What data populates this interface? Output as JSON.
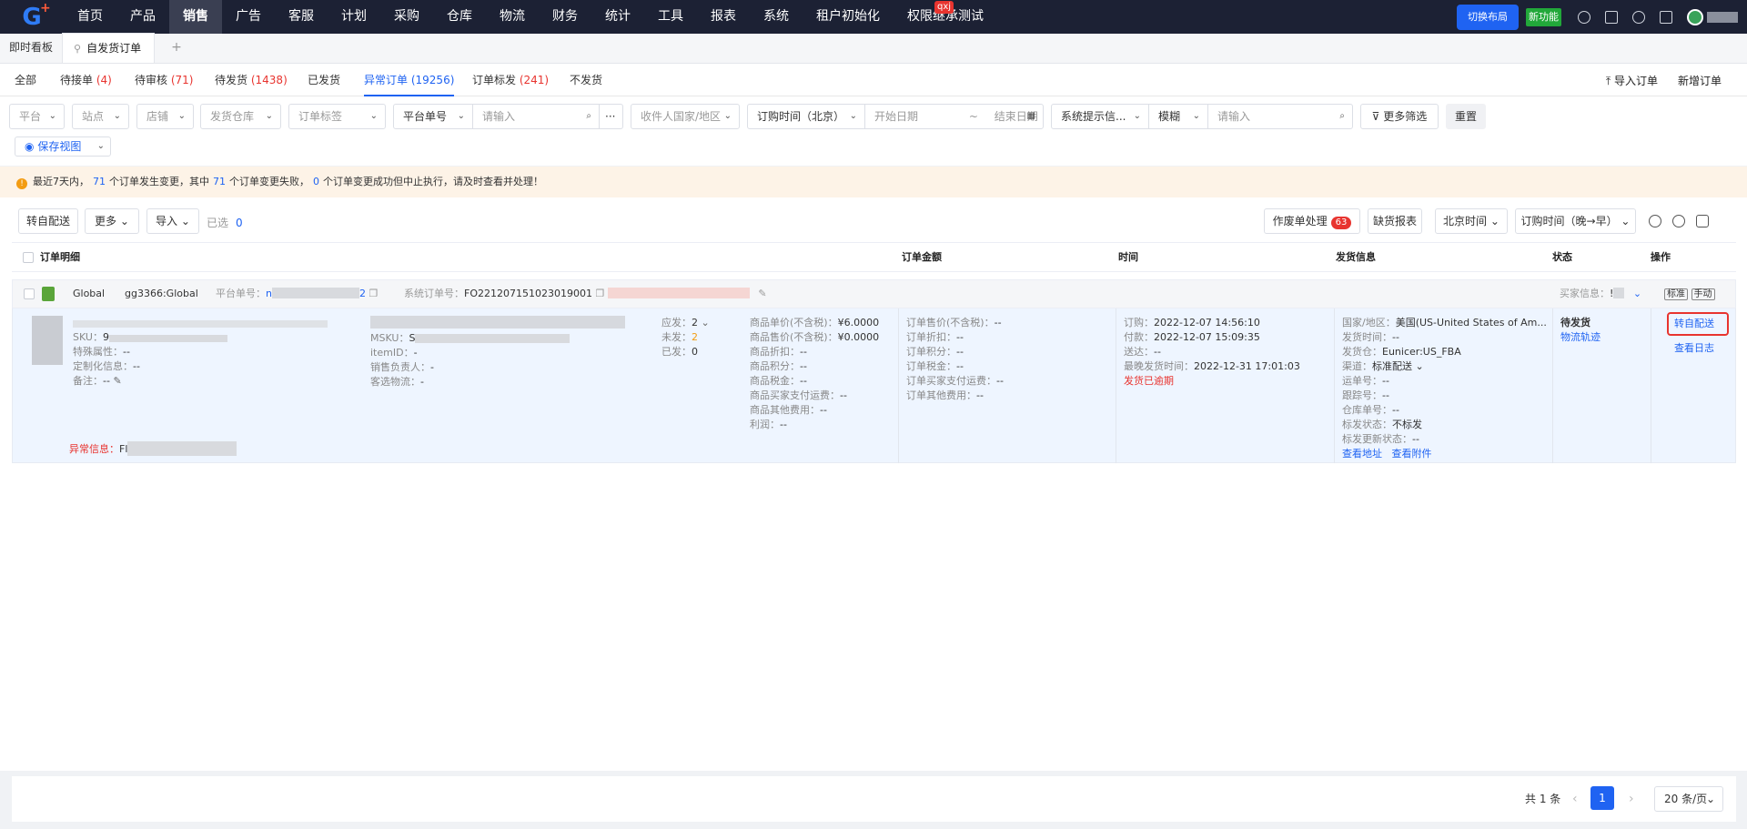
{
  "nav": {
    "logo": "G",
    "items": [
      "首页",
      "产品",
      "销售",
      "广告",
      "客服",
      "计划",
      "采购",
      "仓库",
      "物流",
      "财务",
      "统计",
      "工具",
      "报表",
      "系统",
      "租户初始化",
      "权限继承测试"
    ],
    "active_index": 2,
    "badge": "qxj",
    "switch_layout": "切换布局",
    "new_feature": "新功能"
  },
  "pagetabs": {
    "dashboard": "即时看板",
    "current": "自发货订单",
    "add": "+"
  },
  "status_tabs": [
    {
      "label": "全部",
      "count": ""
    },
    {
      "label": "待接单",
      "count": "(4)"
    },
    {
      "label": "待审核",
      "count": "(71)"
    },
    {
      "label": "待发货",
      "count": "(1438)"
    },
    {
      "label": "已发货",
      "count": ""
    },
    {
      "label": "异常订单",
      "count": "(19256)"
    },
    {
      "label": "订单标发",
      "count": "(241)"
    },
    {
      "label": "不发货",
      "count": ""
    }
  ],
  "top_actions": {
    "import": "导入订单",
    "create": "新增订单"
  },
  "filters": {
    "platform": "平台",
    "site": "站点",
    "store": "店铺",
    "warehouse": "发货仓库",
    "tag": "订单标签",
    "order_no_type": "平台单号",
    "search_placeholder": "请输入",
    "more_dots": "···",
    "country": "收件人国家/地区",
    "time_type": "订购时间（北京）",
    "start_date": "开始日期",
    "date_sep": "~",
    "end_date": "结束日期",
    "sys_hint": "系统提示信...",
    "match": "模糊",
    "search2_placeholder": "请输入",
    "more_filters": "更多筛选",
    "reset": "重置",
    "save_view": "保存视图"
  },
  "alert": {
    "prefix": "最近7天内，",
    "n1": "71",
    "t1": "个订单发生变更，其中",
    "n2": "71",
    "t2": "个订单变更失败，",
    "n3": "0",
    "t3": "个订单变更成功但中止执行，请及时查看并处理！"
  },
  "toolbar": {
    "to_self": "转自配送",
    "more": "更多",
    "import": "导入",
    "selected_label": "已选",
    "selected_count": "0",
    "void_process": "作废单处理",
    "void_count": "63",
    "shortage_report": "缺货报表",
    "beijing_time": "北京时间",
    "sort": "订购时间（晚→早）"
  },
  "table_headers": {
    "detail": "订单明细",
    "amount": "订单金额",
    "time": "时间",
    "shipping": "发货信息",
    "status": "状态",
    "ops": "操作"
  },
  "order": {
    "store_region": "Global",
    "store_name": "gg3366:Global",
    "platform_no_label": "平台单号：",
    "platform_no_start": "n",
    "platform_no_end": "2",
    "sys_no_label": "系统订单号：",
    "sys_no": "FO221207151023019001",
    "buyer_label": "买家信息：",
    "buyer_start": "!",
    "tag_std": "标准",
    "tag_manual": "手动",
    "sku_label": "SKU：",
    "sku_start": "9",
    "special_label": "特殊属性：",
    "special": "--",
    "custom_label": "定制化信息：",
    "custom": "--",
    "note_label": "备注：",
    "note": "--",
    "msku_label": "MSKU：",
    "msku_start": "S",
    "itemid_label": "itemID：",
    "itemid": "-",
    "sales_label": "销售负责人：",
    "sales": "-",
    "cust_logistics_label": "客选物流：",
    "cust_logistics": "-",
    "qty_should_label": "应发：",
    "qty_should": "2",
    "qty_unsent_label": "未发：",
    "qty_unsent": "2",
    "qty_sent_label": "已发：",
    "qty_sent": "0",
    "price_rows": [
      {
        "label": "商品单价(不含税)：",
        "value": "¥6.0000"
      },
      {
        "label": "商品售价(不含税)：",
        "value": "¥0.0000"
      },
      {
        "label": "商品折扣：",
        "value": "--"
      },
      {
        "label": "商品积分：",
        "value": "--"
      },
      {
        "label": "商品税金：",
        "value": "--"
      },
      {
        "label": "商品买家支付运费：",
        "value": "--"
      },
      {
        "label": "商品其他费用：",
        "value": "--"
      },
      {
        "label": "利润：",
        "value": "--"
      }
    ],
    "amount_rows": [
      {
        "label": "订单售价(不含税)：",
        "value": "--"
      },
      {
        "label": "订单折扣：",
        "value": "--"
      },
      {
        "label": "订单积分：",
        "value": "--"
      },
      {
        "label": "订单税金：",
        "value": "--"
      },
      {
        "label": "订单买家支付运费：",
        "value": "--"
      },
      {
        "label": "订单其他费用：",
        "value": "--"
      }
    ],
    "time_rows": [
      {
        "label": "订购：",
        "value": "2022-12-07 14:56:10"
      },
      {
        "label": "付款：",
        "value": "2022-12-07 15:09:35"
      },
      {
        "label": "送达：",
        "value": "--"
      },
      {
        "label": "最晚发货时间：",
        "value": "2022-12-31 17:01:03"
      }
    ],
    "overdue": "发货已逾期",
    "ship_rows": [
      {
        "label": "国家/地区：",
        "value": "美国(US-United States of Am..."
      },
      {
        "label": "发货时间：",
        "value": "--"
      },
      {
        "label": "发货仓：",
        "value": "Eunicer:US_FBA"
      },
      {
        "label": "渠道：",
        "value": "标准配送"
      },
      {
        "label": "运单号：",
        "value": "--"
      },
      {
        "label": "跟踪号：",
        "value": "--"
      },
      {
        "label": "仓库单号：",
        "value": "--"
      },
      {
        "label": "标发状态：",
        "value": "不标发"
      },
      {
        "label": "标发更新状态：",
        "value": "--"
      }
    ],
    "view_address": "查看地址",
    "view_attach": "查看附件",
    "status": "待发货",
    "logistics_track": "物流轨迹",
    "op_to_self": "转自配送",
    "op_log": "查看日志",
    "exception_label": "异常信息：",
    "exception_start": "Fl"
  },
  "pager": {
    "total": "共 1 条",
    "prev": "‹",
    "page": "1",
    "next": "›",
    "size": "20 条/页"
  }
}
